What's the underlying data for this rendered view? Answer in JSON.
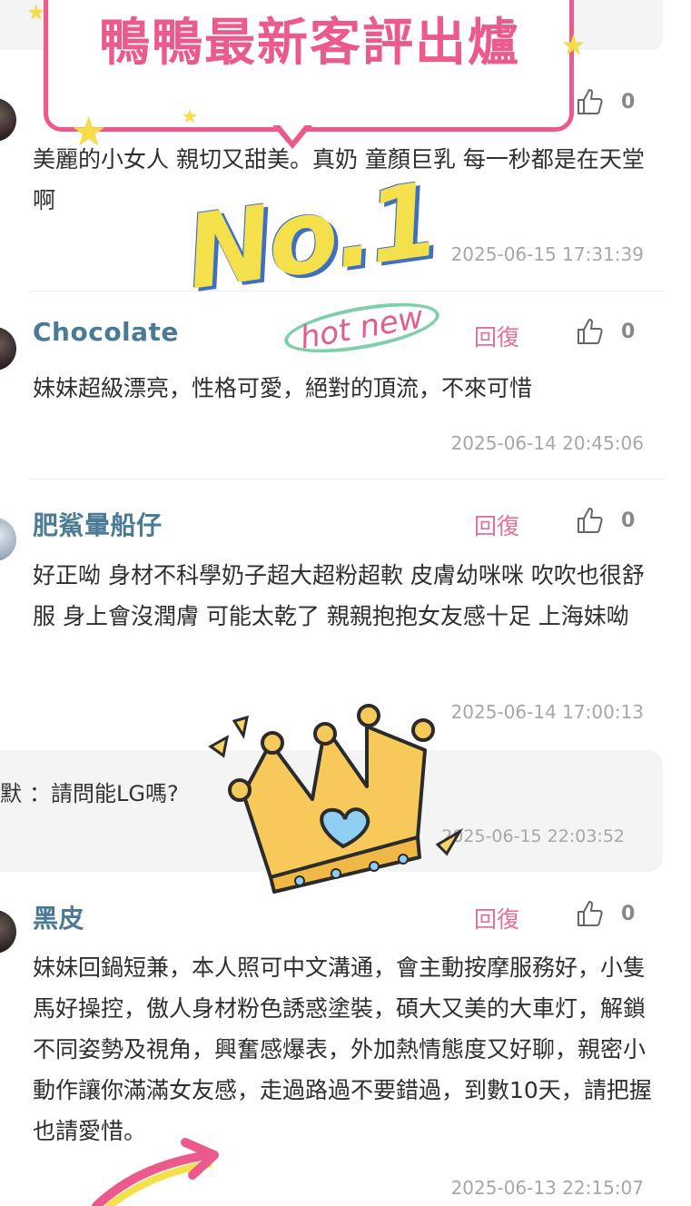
{
  "banner": {
    "title": "鴨鴨最新客評出爐"
  },
  "sticker": {
    "no1": "No.1",
    "hotnew": "hot new"
  },
  "comments": [
    {
      "name": "",
      "reply_label": "",
      "likes": "0",
      "text": "美麗的小女人 親切又甜美。真奶 童顏巨乳 每一秒都是在天堂啊",
      "time": "2025-06-15 17:31:39"
    },
    {
      "name": "Chocolate",
      "reply_label": "回復",
      "likes": "0",
      "text": "妹妹超級漂亮，性格可愛，絕對的頂流，不來可惜",
      "time": "2025-06-14 20:45:06"
    },
    {
      "name": "肥鯊暈船仔",
      "reply_label": "回復",
      "likes": "0",
      "text": "好正呦 身材不科學奶子超大超粉超軟 皮膚幼咪咪 吹吹也很舒服 身上會沒潤膚 可能太乾了 親親抱抱女友感十足 上海妹呦",
      "time": "2025-06-14 17:00:13"
    },
    {
      "name": "黑皮",
      "reply_label": "回復",
      "likes": "0",
      "text": "妹妹回鍋短兼，本人照可中文溝通，會主動按摩服務好，小隻馬好操控，傲人身材粉色誘惑塗裝，碩大又美的大車灯，解鎖不同姿勢及視角，興奮感爆表，外加熱情態度又好聊，親密小動作讓你滿滿女友感，走過路過不要錯過，到數10天，請把握也請愛惜。",
      "time": "2025-06-13 22:15:07"
    }
  ],
  "sub_reply": {
    "author": "默",
    "text": "：請問能LG嗎?",
    "time": "2025-06-15 22:03:52"
  },
  "icons": {
    "like": "thumbs-up-icon"
  },
  "colors": {
    "name": "#4b7a95",
    "reply": "#e56f99",
    "banner": "#ea5a8d",
    "time": "#a7a7a7"
  }
}
